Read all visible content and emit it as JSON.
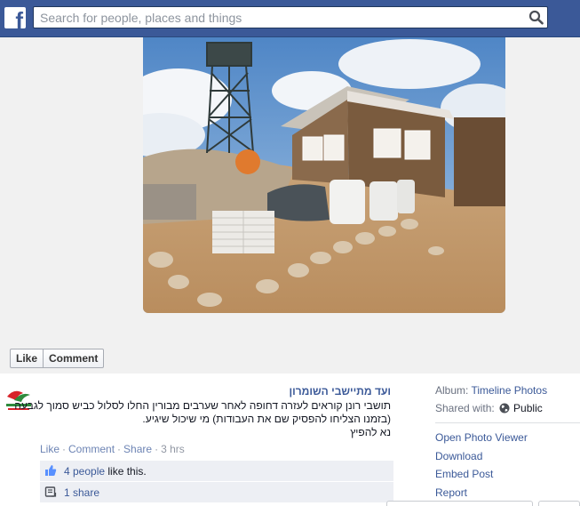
{
  "header": {
    "logo_letter": "f",
    "search_placeholder": "Search for people, places and things"
  },
  "photo_actions": {
    "like_label": "Like",
    "comment_label": "Comment"
  },
  "post": {
    "page_name": "ועד מתיישבי השומרון",
    "caption_lines": [
      "תושבי רונן קוראים לעזרה דחופה לאחר שערבים מבורין החלו לסלול כביש סמוך לגבעה",
      "(בזמנו הצליחו להפסיק שם את העבודות) מי שיכול שיגיע.",
      "נא להפיץ"
    ],
    "meta": {
      "like": "Like",
      "comment": "Comment",
      "share": "Share",
      "time": "3 hrs",
      "separator": "·"
    },
    "likes": {
      "count_link": "4 people",
      "suffix": " like this."
    },
    "shares": {
      "label": "1 share"
    }
  },
  "sidebar": {
    "album_label": "Album: ",
    "album_value": "Timeline Photos",
    "shared_label": "Shared with: ",
    "shared_value": "Public",
    "links": [
      "Open Photo Viewer",
      "Download",
      "Embed Post",
      "Report"
    ]
  },
  "colors": {
    "brand": "#3b5998",
    "stage_bg": "#f1f1f1",
    "sky": "#5b8fc9"
  },
  "icons": {
    "logo": "facebook-f-logo",
    "search": "magnifier-icon",
    "thumbs_up": "thumbs-up-icon",
    "share": "share-icon",
    "globe": "globe-icon"
  }
}
